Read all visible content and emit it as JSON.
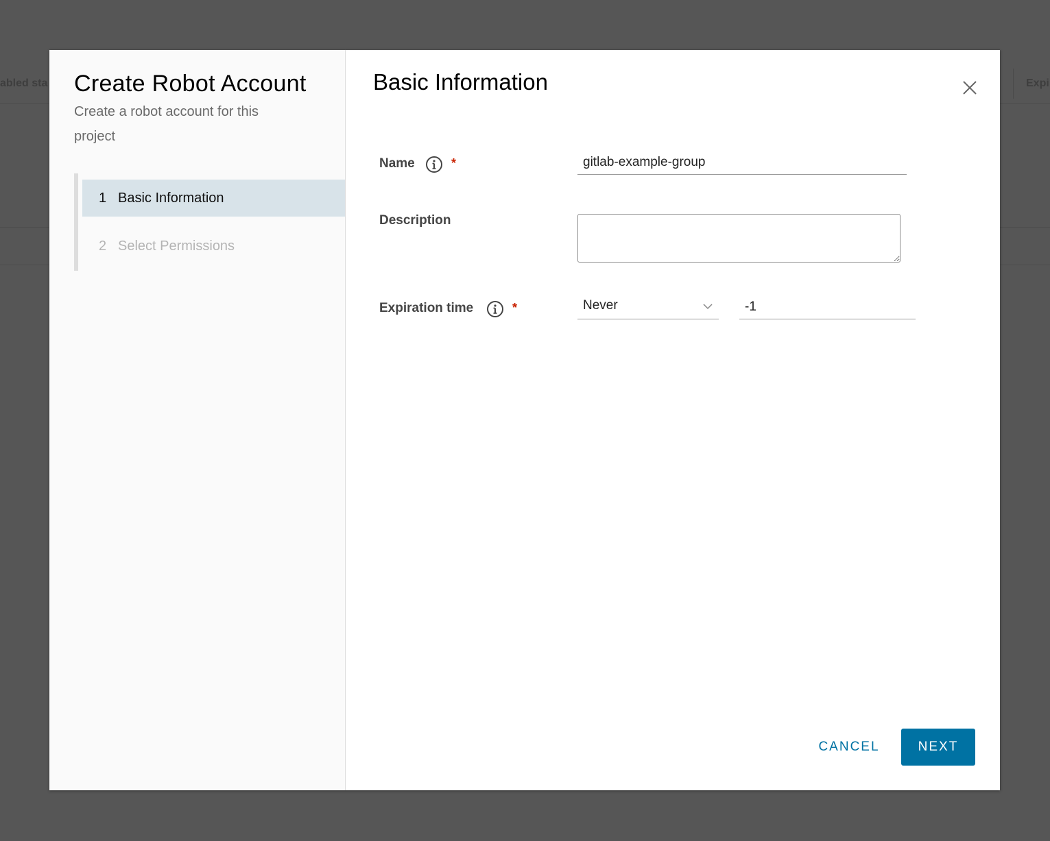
{
  "background": {
    "column_left": "abled sta",
    "column_right": "Expi"
  },
  "modal": {
    "title": "Create Robot Account",
    "subtitle": "Create a robot account for this project",
    "steps": [
      {
        "number": "1",
        "label": "Basic Information",
        "active": true
      },
      {
        "number": "2",
        "label": "Select Permissions",
        "active": false
      }
    ],
    "content_title": "Basic Information",
    "form": {
      "name": {
        "label": "Name",
        "value": "gitlab-example-group",
        "required_mark": "*"
      },
      "description": {
        "label": "Description",
        "value": ""
      },
      "expiration": {
        "label": "Expiration time",
        "selected": "Never",
        "value": "-1",
        "required_mark": "*"
      }
    },
    "buttons": {
      "cancel": "CANCEL",
      "next": "NEXT"
    }
  },
  "colors": {
    "overlay": "#565656",
    "primary": "#0072a3",
    "active_step_bg": "#d8e3e9",
    "required": "#c92100"
  },
  "icons": {
    "info": "info-circle-icon",
    "close": "close-icon",
    "chevron": "chevron-down-icon"
  }
}
